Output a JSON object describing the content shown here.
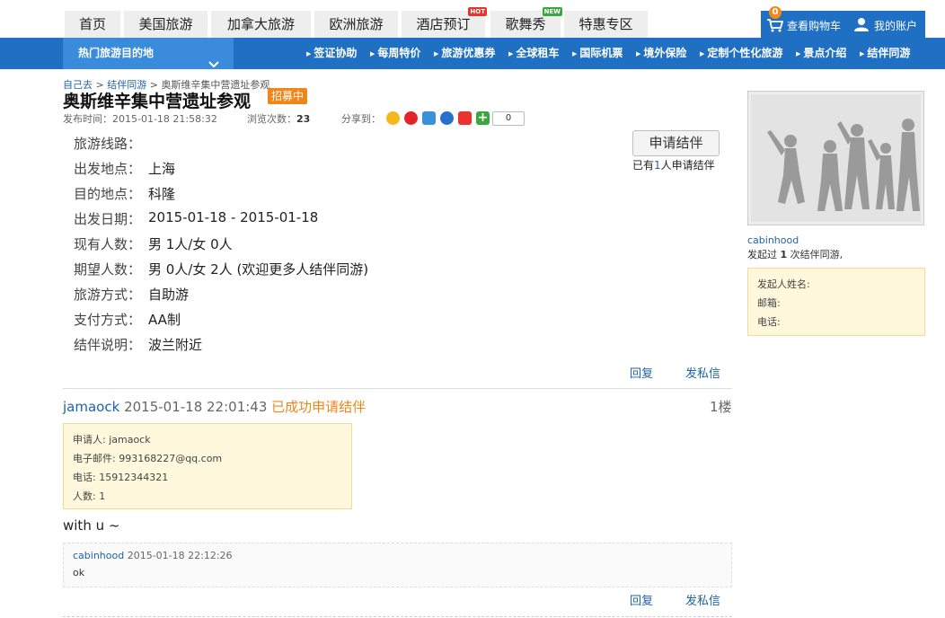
{
  "nav": {
    "tabs": [
      {
        "label": "首页"
      },
      {
        "label": "美国旅游"
      },
      {
        "label": "加拿大旅游"
      },
      {
        "label": "欧洲旅游"
      },
      {
        "label": "酒店预订",
        "badge": "HOT"
      },
      {
        "label": "歌舞秀",
        "badge": "NEW"
      },
      {
        "label": "特惠专区"
      }
    ],
    "cart_count": "0",
    "cart_label": "查看购物车",
    "account_label": "我的账户"
  },
  "bluebar": {
    "dest_label": "热门旅游目的地",
    "links": [
      "签证协助",
      "每周特价",
      "旅游优惠券",
      "全球租车",
      "国际机票",
      "境外保险",
      "定制个性化旅游",
      "景点介绍",
      "结伴同游"
    ]
  },
  "breadcrumb": {
    "home": "自己去",
    "section": "结伴同游",
    "sep": ">",
    "current": "奥斯维辛集中营遗址参观"
  },
  "post": {
    "title": "奥斯维辛集中营遗址参观",
    "status_badge": "招募中",
    "publish_label": "发布时间：",
    "publish_time": "2015-01-18 21:58:32",
    "views_label": "浏览次数：",
    "views": "23",
    "share_label": "分享到：",
    "share_count": "0",
    "fields": [
      {
        "label": "旅游线路：",
        "value": ""
      },
      {
        "label": "出发地点：",
        "value": "上海"
      },
      {
        "label": "目的地点：",
        "value": "科隆"
      },
      {
        "label": "出发日期：",
        "value": "2015-01-18 - 2015-01-18"
      },
      {
        "label": "现有人数：",
        "value": "男 1人/女 0人"
      },
      {
        "label": "期望人数：",
        "value": "男 0人/女 2人 (欢迎更多人结伴同游)"
      },
      {
        "label": "旅游方式：",
        "value": "自助游"
      },
      {
        "label": "支付方式：",
        "value": "AA制"
      },
      {
        "label": "结伴说明：",
        "value": "波兰附近"
      }
    ],
    "apply_button": "申请结伴",
    "apply_pre": "已有",
    "apply_num": "1",
    "apply_post": "人申请结伴",
    "reply_label": "回复",
    "message_label": "发私信"
  },
  "reply": {
    "user": "jamaock",
    "time": "2015-01-18 22:01:43",
    "status": "已成功申请结伴",
    "floor": "1楼",
    "app": {
      "applicant": "申请人: jamaock",
      "email": "电子邮件: 993168227@qq.com",
      "phone": "电话: 15912344321",
      "count": "人数: 1"
    },
    "text": "with u ~",
    "sub": {
      "user": "cabinhood",
      "time": "2015-01-18 22:12:26",
      "text": "ok"
    },
    "reply_label": "回复",
    "message_label": "发私信"
  },
  "sidebar": {
    "username": "cabinhood",
    "count_pre": "发起过",
    "count_num": "1",
    "count_post": "次结伴同游,",
    "name_label": "发起人姓名:",
    "email_label": "邮箱:",
    "phone_label": "电话:"
  }
}
